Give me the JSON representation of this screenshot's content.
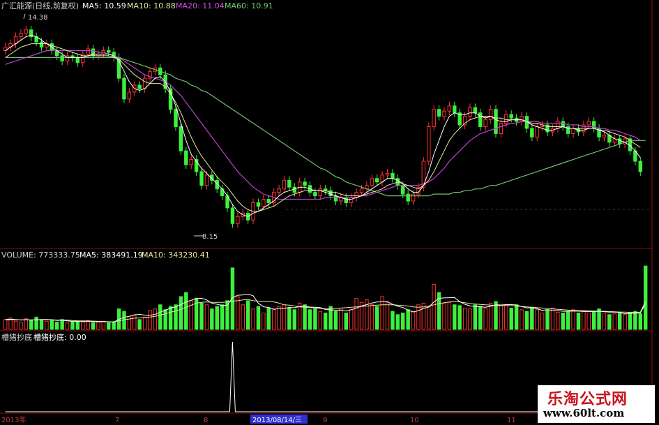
{
  "header": {
    "name": "广汇能源(日线,前复权)",
    "ma5": "MA5: 10.59",
    "ma10": "MA10: 10.88",
    "ma20": "MA20: 11.04",
    "ma60": "MA60: 10.91"
  },
  "price_labels": {
    "high": "14.38",
    "low": "8.15"
  },
  "volume_header": {
    "volume": "VOLUME: 773333.75",
    "ma5": "MA5: 383491.19",
    "ma10": "MA10: 343230.41"
  },
  "indicator_header": {
    "name": "槽猪抄底",
    "value": "槽猪抄底: 0.00"
  },
  "x_axis": {
    "labels": [
      "2013年",
      "7",
      "8",
      "2013/08/14/三",
      "9",
      "10",
      "11"
    ],
    "highlighted": "2013/08/14/三"
  },
  "watermark": {
    "name": "乐淘公式网",
    "url": "www.60lt.com"
  },
  "colors": {
    "up": "#ff3232",
    "down": "#3cf03c",
    "ma5": "#ffffff",
    "ma10": "#e8e8a0",
    "ma20": "#c040d0",
    "ma60": "#70c070",
    "grid": "#8a1010",
    "cursor": "#3030d0"
  },
  "chart_data": [
    {
      "type": "candlestick",
      "title": "广汇能源(日线,前复权)",
      "x_start": "2013-06",
      "x_end": "2013-11",
      "ylim": [
        8.0,
        14.6
      ],
      "marked_high": 14.38,
      "marked_low": 8.15,
      "close": [
        13.6,
        13.7,
        13.9,
        14.0,
        14.1,
        13.9,
        13.75,
        13.6,
        13.7,
        13.5,
        13.35,
        13.2,
        13.35,
        13.3,
        13.15,
        13.4,
        13.55,
        13.35,
        13.4,
        13.5,
        13.45,
        13.3,
        12.7,
        12.1,
        12.3,
        12.5,
        12.4,
        12.7,
        12.9,
        13.0,
        12.8,
        12.4,
        11.8,
        11.3,
        10.6,
        10.2,
        10.35,
        10.0,
        9.6,
        9.9,
        9.75,
        9.5,
        9.3,
        8.95,
        8.5,
        8.7,
        8.8,
        8.6,
        9.1,
        9.0,
        9.2,
        9.1,
        9.4,
        9.5,
        9.75,
        9.55,
        9.4,
        9.7,
        9.6,
        9.4,
        9.3,
        9.5,
        9.45,
        9.3,
        9.15,
        9.25,
        9.1,
        9.25,
        9.4,
        9.5,
        9.6,
        9.8,
        9.7,
        9.9,
        9.95,
        9.8,
        9.6,
        9.35,
        9.15,
        9.35,
        9.55,
        10.3,
        11.3,
        11.8,
        11.6,
        11.75,
        11.9,
        11.7,
        11.35,
        11.6,
        11.85,
        11.7,
        11.3,
        11.5,
        11.8,
        11.1,
        11.4,
        11.65,
        11.55,
        11.45,
        11.6,
        11.25,
        11.0,
        11.3,
        11.35,
        11.15,
        11.25,
        11.45,
        11.3,
        11.1,
        11.25,
        11.15,
        11.35,
        11.45,
        11.25,
        11.0,
        11.05,
        10.85,
        10.95,
        10.8,
        10.95,
        10.6,
        10.3,
        10.0
      ],
      "ma5": [
        13.5,
        13.6,
        13.7,
        13.8,
        13.9,
        13.95,
        13.9,
        13.8,
        13.7,
        13.6,
        13.5,
        13.4,
        13.3,
        13.3,
        13.3,
        13.3,
        13.35,
        13.4,
        13.4,
        13.4,
        13.4,
        13.35,
        13.2,
        12.9,
        12.6,
        12.4,
        12.35,
        12.4,
        12.55,
        12.7,
        12.75,
        12.6,
        12.3,
        11.9,
        11.4,
        10.9,
        10.5,
        10.3,
        10.1,
        9.95,
        9.8,
        9.65,
        9.5,
        9.3,
        9.05,
        8.85,
        8.75,
        8.7,
        8.8,
        8.85,
        8.95,
        9.05,
        9.15,
        9.3,
        9.4,
        9.45,
        9.5,
        9.55,
        9.55,
        9.5,
        9.45,
        9.45,
        9.4,
        9.35,
        9.3,
        9.25,
        9.2,
        9.2,
        9.25,
        9.3,
        9.4,
        9.5,
        9.6,
        9.7,
        9.8,
        9.8,
        9.75,
        9.65,
        9.5,
        9.4,
        9.4,
        9.6,
        10.0,
        10.5,
        10.9,
        11.3,
        11.6,
        11.7,
        11.65,
        11.65,
        11.7,
        11.7,
        11.6,
        11.55,
        11.6,
        11.5,
        11.45,
        11.45,
        11.5,
        11.5,
        11.5,
        11.45,
        11.35,
        11.3,
        11.25,
        11.2,
        11.2,
        11.25,
        11.3,
        11.25,
        11.25,
        11.2,
        11.2,
        11.25,
        11.25,
        11.2,
        11.15,
        11.05,
        10.95,
        10.9,
        10.85,
        10.75,
        10.6,
        10.4
      ],
      "ma10": [
        13.3,
        13.4,
        13.5,
        13.6,
        13.65,
        13.7,
        13.7,
        13.7,
        13.7,
        13.65,
        13.6,
        13.55,
        13.5,
        13.45,
        13.4,
        13.35,
        13.35,
        13.35,
        13.35,
        13.35,
        13.35,
        13.3,
        13.25,
        13.1,
        12.95,
        12.8,
        12.7,
        12.6,
        12.55,
        12.55,
        12.55,
        12.45,
        12.25,
        12.0,
        11.7,
        11.35,
        11.0,
        10.7,
        10.45,
        10.25,
        10.05,
        9.85,
        9.7,
        9.55,
        9.35,
        9.15,
        9.0,
        8.9,
        8.85,
        8.85,
        8.9,
        8.95,
        9.0,
        9.1,
        9.2,
        9.3,
        9.35,
        9.4,
        9.45,
        9.45,
        9.45,
        9.45,
        9.45,
        9.4,
        9.4,
        9.35,
        9.3,
        9.3,
        9.3,
        9.3,
        9.35,
        9.4,
        9.45,
        9.5,
        9.6,
        9.65,
        9.7,
        9.65,
        9.6,
        9.55,
        9.5,
        9.6,
        9.75,
        10.0,
        10.3,
        10.6,
        10.9,
        11.1,
        11.25,
        11.4,
        11.5,
        11.55,
        11.6,
        11.6,
        11.6,
        11.55,
        11.55,
        11.5,
        11.5,
        11.5,
        11.5,
        11.45,
        11.4,
        11.4,
        11.35,
        11.3,
        11.3,
        11.3,
        11.3,
        11.25,
        11.25,
        11.25,
        11.25,
        11.25,
        11.25,
        11.2,
        11.2,
        11.15,
        11.1,
        11.05,
        11.0,
        10.9,
        10.8,
        10.7
      ],
      "ma20": [
        13.1,
        13.15,
        13.2,
        13.25,
        13.3,
        13.35,
        13.4,
        13.45,
        13.5,
        13.5,
        13.5,
        13.5,
        13.5,
        13.5,
        13.5,
        13.5,
        13.5,
        13.5,
        13.45,
        13.45,
        13.4,
        13.35,
        13.3,
        13.2,
        13.1,
        13.0,
        12.9,
        12.8,
        12.75,
        12.7,
        12.65,
        12.6,
        12.5,
        12.35,
        12.2,
        12.0,
        11.8,
        11.6,
        11.4,
        11.2,
        11.0,
        10.8,
        10.6,
        10.4,
        10.2,
        10.0,
        9.85,
        9.7,
        9.55,
        9.45,
        9.35,
        9.3,
        9.25,
        9.2,
        9.2,
        9.2,
        9.2,
        9.2,
        9.2,
        9.2,
        9.2,
        9.2,
        9.25,
        9.25,
        9.25,
        9.25,
        9.25,
        9.25,
        9.25,
        9.3,
        9.3,
        9.35,
        9.4,
        9.45,
        9.5,
        9.55,
        9.6,
        9.6,
        9.6,
        9.6,
        9.6,
        9.65,
        9.7,
        9.8,
        9.95,
        10.1,
        10.3,
        10.45,
        10.6,
        10.75,
        10.9,
        11.0,
        11.1,
        11.15,
        11.2,
        11.25,
        11.3,
        11.35,
        11.4,
        11.4,
        11.45,
        11.45,
        11.45,
        11.45,
        11.4,
        11.4,
        11.4,
        11.4,
        11.4,
        11.35,
        11.35,
        11.35,
        11.3,
        11.3,
        11.3,
        11.25,
        11.25,
        11.2,
        11.2,
        11.15,
        11.1,
        11.05,
        11.0,
        10.9
      ],
      "ma60": [
        13.3,
        13.3,
        13.3,
        13.3,
        13.3,
        13.3,
        13.3,
        13.3,
        13.3,
        13.3,
        13.3,
        13.3,
        13.3,
        13.3,
        13.3,
        13.3,
        13.3,
        13.3,
        13.3,
        13.3,
        13.3,
        13.3,
        13.3,
        13.25,
        13.2,
        13.15,
        13.1,
        13.05,
        13.0,
        12.95,
        12.9,
        12.85,
        12.8,
        12.7,
        12.65,
        12.6,
        12.5,
        12.45,
        12.35,
        12.3,
        12.2,
        12.1,
        12.0,
        11.9,
        11.8,
        11.7,
        11.6,
        11.5,
        11.4,
        11.3,
        11.2,
        11.1,
        11.0,
        10.9,
        10.8,
        10.7,
        10.6,
        10.5,
        10.4,
        10.3,
        10.2,
        10.1,
        10.05,
        9.95,
        9.85,
        9.8,
        9.7,
        9.65,
        9.6,
        9.55,
        9.5,
        9.45,
        9.4,
        9.35,
        9.3,
        9.3,
        9.3,
        9.3,
        9.3,
        9.3,
        9.3,
        9.3,
        9.3,
        9.35,
        9.35,
        9.35,
        9.35,
        9.4,
        9.4,
        9.45,
        9.45,
        9.5,
        9.5,
        9.55,
        9.6,
        9.6,
        9.65,
        9.7,
        9.75,
        9.8,
        9.85,
        9.9,
        9.95,
        10.0,
        10.05,
        10.1,
        10.15,
        10.2,
        10.25,
        10.3,
        10.35,
        10.4,
        10.45,
        10.5,
        10.55,
        10.6,
        10.65,
        10.7,
        10.75,
        10.8,
        10.85,
        10.9,
        10.9,
        10.9,
        10.9
      ]
    },
    {
      "type": "bar",
      "title": "VOLUME",
      "ylim": [
        0,
        800000
      ],
      "values": [
        120000,
        140000,
        100000,
        90000,
        130000,
        110000,
        150000,
        120000,
        100000,
        110000,
        90000,
        120000,
        80000,
        90000,
        100000,
        90000,
        110000,
        80000,
        90000,
        100000,
        80000,
        90000,
        250000,
        220000,
        160000,
        170000,
        120000,
        150000,
        230000,
        250000,
        300000,
        240000,
        280000,
        300000,
        400000,
        450000,
        350000,
        380000,
        320000,
        300000,
        250000,
        280000,
        300000,
        350000,
        750000,
        400000,
        300000,
        350000,
        250000,
        280000,
        200000,
        260000,
        240000,
        280000,
        300000,
        260000,
        240000,
        320000,
        300000,
        240000,
        250000,
        220000,
        200000,
        280000,
        220000,
        260000,
        200000,
        240000,
        380000,
        330000,
        360000,
        300000,
        280000,
        400000,
        330000,
        220000,
        180000,
        200000,
        240000,
        220000,
        300000,
        320000,
        280000,
        550000,
        450000,
        320000,
        330000,
        300000,
        290000,
        260000,
        250000,
        300000,
        280000,
        260000,
        320000,
        340000,
        290000,
        300000,
        260000,
        300000,
        240000,
        220000,
        260000,
        240000,
        200000,
        240000,
        260000,
        210000,
        200000,
        220000,
        240000,
        200000,
        230000,
        200000,
        220000,
        250000,
        200000,
        180000,
        190000,
        200000,
        180000,
        200000,
        220000,
        190000,
        773333
      ],
      "ma5": [
        120000,
        125000,
        120000,
        115000,
        118000,
        114000,
        116000,
        120000,
        122000,
        118000,
        108000,
        112000,
        104000,
        98000,
        96000,
        96000,
        98000,
        94000,
        94000,
        96000,
        92000,
        90000,
        122000,
        148000,
        160000,
        178000,
        184000,
        174000,
        170000,
        184000,
        210000,
        234000,
        260000,
        274000,
        304000,
        334000,
        356000,
        376000,
        380000,
        360000,
        320000,
        306000,
        290000,
        296000,
        386000,
        416000,
        420000,
        430000,
        410000,
        318000,
        276000,
        268000,
        246000,
        254000,
        256000,
        268000,
        264000,
        280000,
        284000,
        272000,
        270000,
        266000,
        242000,
        238000,
        234000,
        236000,
        224000,
        240000,
        260000,
        286000,
        302000,
        322000,
        334000,
        336000,
        338000,
        306000,
        282000,
        266000,
        234000,
        212000,
        228000,
        256000,
        272000,
        334000,
        380000,
        384000,
        386000,
        390000,
        338000,
        306000,
        286000,
        280000,
        276000,
        270000,
        282000,
        300000,
        298000,
        302000,
        302000,
        298000,
        278000,
        262000,
        264000,
        252000,
        232000,
        240000,
        232000,
        230000,
        220000,
        222000,
        222000,
        222000,
        218000,
        218000,
        218000,
        220000,
        216000,
        210000,
        210000,
        208000,
        190000,
        196000,
        198000,
        200000,
        316000
      ],
      "ma10": [
        115000,
        118000,
        117000,
        116000,
        117000,
        116000,
        117000,
        118000,
        119000,
        117000,
        113000,
        114000,
        112000,
        108000,
        105000,
        104000,
        103000,
        101000,
        99000,
        97000,
        94000,
        93000,
        105000,
        118000,
        127000,
        137000,
        140000,
        142000,
        150000,
        160000,
        175000,
        190000,
        210000,
        225000,
        245000,
        270000,
        295000,
        320000,
        330000,
        335000,
        330000,
        330000,
        330000,
        335000,
        345000,
        350000,
        360000,
        365000,
        350000,
        345000,
        340000,
        340000,
        335000,
        320000,
        300000,
        295000,
        285000,
        275000,
        270000,
        265000,
        260000,
        255000,
        250000,
        250000,
        255000,
        260000,
        265000,
        270000,
        275000,
        280000,
        285000,
        290000,
        295000,
        300000,
        300000,
        300000,
        295000,
        290000,
        285000,
        275000,
        270000,
        275000,
        285000,
        300000,
        315000,
        325000,
        335000,
        340000,
        335000,
        325000,
        315000,
        310000,
        305000,
        300000,
        295000,
        290000,
        290000,
        290000,
        290000,
        285000,
        280000,
        275000,
        270000,
        265000,
        260000,
        255000,
        250000,
        245000,
        240000,
        235000,
        232000,
        230000,
        228000,
        226000,
        224000,
        222000,
        220000,
        218000,
        215000,
        212000,
        210000,
        208000,
        208000,
        210000,
        343230
      ]
    },
    {
      "type": "line",
      "title": "槽猪抄底",
      "values_note_free": true,
      "values": [
        0,
        0,
        0,
        0,
        0,
        0,
        0,
        0,
        0,
        0,
        0,
        0,
        0,
        0,
        0,
        0,
        0,
        0,
        0,
        0,
        0,
        0,
        0,
        0,
        0,
        0,
        0,
        0,
        0,
        0,
        0,
        0,
        0,
        0,
        0,
        0,
        0,
        0,
        0,
        0,
        0,
        0,
        0,
        0,
        1,
        0,
        0,
        0,
        0,
        0,
        0,
        0,
        0,
        0,
        0,
        0,
        0,
        0,
        0,
        0,
        0,
        0,
        0,
        0,
        0,
        0,
        0,
        0,
        0,
        0,
        0,
        0,
        0,
        0,
        0,
        0,
        0,
        0,
        0,
        0,
        0,
        0,
        0,
        0,
        0,
        0,
        0,
        0,
        0,
        0,
        0,
        0,
        0,
        0,
        0,
        0,
        0,
        0,
        0,
        0,
        0,
        0,
        0,
        0,
        0,
        0,
        0,
        0,
        0,
        0,
        0,
        0,
        0,
        0,
        0,
        0,
        0,
        0,
        0,
        0,
        0,
        0,
        0,
        0,
        0
      ]
    }
  ]
}
